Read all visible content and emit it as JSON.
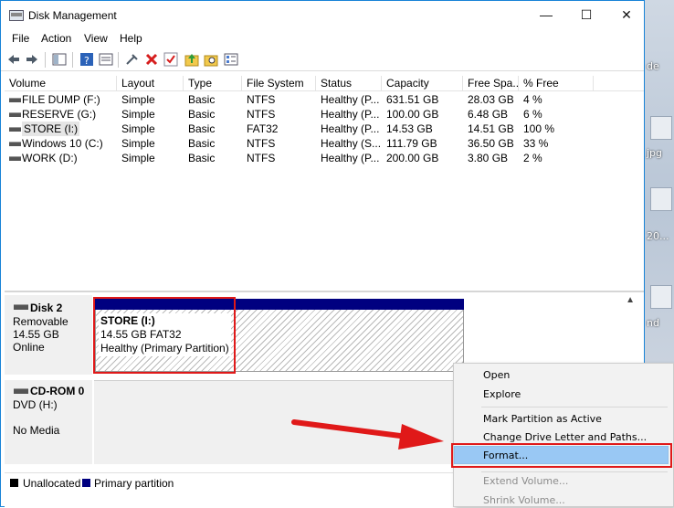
{
  "window": {
    "title": "Disk Management"
  },
  "window_controls": {
    "minimize": "—",
    "maximize": "☐",
    "close": "✕"
  },
  "menu": [
    "File",
    "Action",
    "View",
    "Help"
  ],
  "volume_table": {
    "headers": [
      "Volume",
      "Layout",
      "Type",
      "File System",
      "Status",
      "Capacity",
      "Free Spa...",
      "% Free"
    ],
    "rows": [
      [
        "FILE DUMP (F:)",
        "Simple",
        "Basic",
        "NTFS",
        "Healthy (P...",
        "631.51 GB",
        "28.03 GB",
        "4 %"
      ],
      [
        "RESERVE (G:)",
        "Simple",
        "Basic",
        "NTFS",
        "Healthy (P...",
        "100.00 GB",
        "6.48 GB",
        "6 %"
      ],
      [
        "STORE (I:)",
        "Simple",
        "Basic",
        "FAT32",
        "Healthy (P...",
        "14.53 GB",
        "14.51 GB",
        "100 %"
      ],
      [
        "Windows 10 (C:)",
        "Simple",
        "Basic",
        "NTFS",
        "Healthy (S...",
        "111.79 GB",
        "36.50 GB",
        "33 %"
      ],
      [
        "WORK (D:)",
        "Simple",
        "Basic",
        "NTFS",
        "Healthy (P...",
        "200.00 GB",
        "3.80 GB",
        "2 %"
      ]
    ]
  },
  "disks": [
    {
      "name": "Disk 2",
      "kind": "Removable",
      "size": "14.55 GB",
      "state": "Online"
    },
    {
      "name": "CD-ROM 0",
      "kind": "DVD (H:)",
      "state": "No Media"
    }
  ],
  "partition": {
    "name": "STORE  (I:)",
    "size_fs": "14.55 GB FAT32",
    "status": "Healthy (Primary Partition)",
    "bar_color": "#000080"
  },
  "legend": [
    {
      "label": "Unallocated",
      "color": "#000000"
    },
    {
      "label": "Primary partition",
      "color": "#000080"
    }
  ],
  "context_menu": {
    "items": [
      "Open",
      "Explore",
      "Mark Partition as Active",
      "Change Drive Letter and Paths...",
      "Format...",
      "Extend Volume...",
      "Shrink Volume..."
    ],
    "highlighted": "Format...",
    "disabled": [
      "Extend Volume...",
      "Shrink Volume..."
    ]
  },
  "desktop_fragments": [
    "de",
    "jpg",
    "20...",
    "nd"
  ],
  "annotation_color": "#e01919"
}
